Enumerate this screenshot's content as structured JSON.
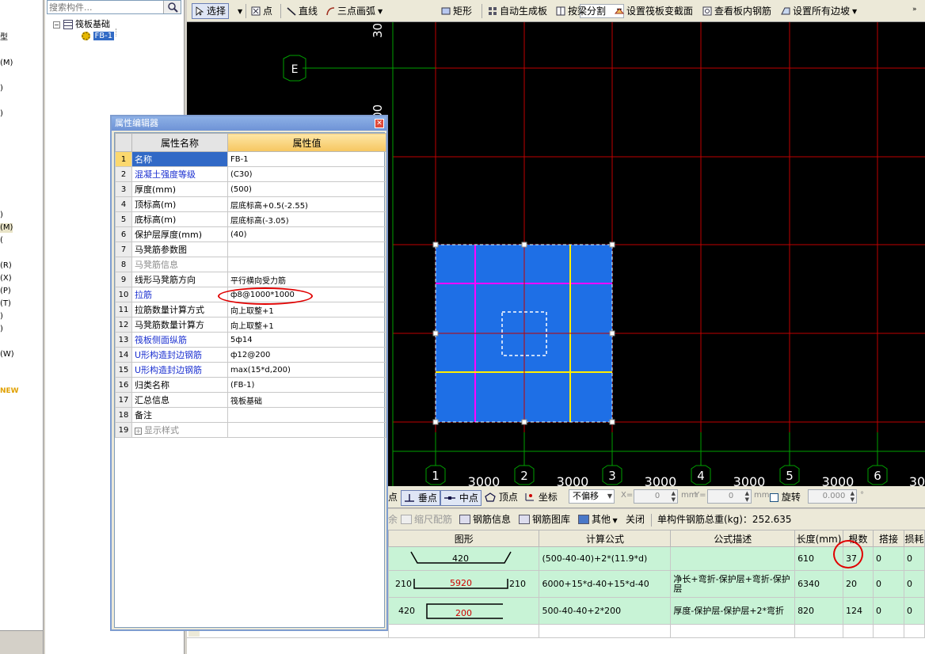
{
  "left_fragments": [
    "型",
    "(M)",
    ")",
    ")",
    ")",
    "(M)",
    "(",
    "(R)",
    "(X)",
    "(P)",
    "(T)",
    ")",
    ")",
    "(W)"
  ],
  "left_new_badge": "NEW",
  "search": {
    "placeholder": "搜索构件..."
  },
  "tree": {
    "root": {
      "label": "筏板基础",
      "toggle": "−"
    },
    "child": {
      "label": "FB-1"
    }
  },
  "toolbar": {
    "select": "选择",
    "point": "点",
    "line": "直线",
    "arc3": "三点画弧",
    "rect": "矩形",
    "autogen": "自动生成板",
    "split_by_beam": "按梁分割",
    "set_slab_section": "设置筏板变截面",
    "view_slab_rebar": "查看板内钢筋",
    "set_all_edges": "设置所有边坡"
  },
  "canvas": {
    "axis_labels_bottom": [
      "1",
      "2",
      "3",
      "4",
      "5",
      "6"
    ],
    "axis_label_left": "E",
    "dimension_labels": [
      "3000",
      "3000",
      "3000",
      "3000",
      "3000",
      "30"
    ],
    "dimension_vertical": [
      "30",
      "3000"
    ],
    "colors": {
      "background": "#000000",
      "grid_red": "#c00000",
      "grid_green": "#00b000",
      "slab_fill": "#1e6fe6",
      "rebar_magenta": "#ff00ff",
      "rebar_yellow": "#ffee00"
    }
  },
  "prop_editor": {
    "title": "属性编辑器",
    "col_name": "属性名称",
    "col_value": "属性值",
    "rows": [
      {
        "num": "1",
        "name": "名称",
        "value": "FB-1"
      },
      {
        "num": "2",
        "name": "混凝土强度等级",
        "value": "(C30)"
      },
      {
        "num": "3",
        "name": "厚度(mm)",
        "value": "(500)"
      },
      {
        "num": "4",
        "name": "顶标高(m)",
        "value": "层底标高+0.5(-2.55)"
      },
      {
        "num": "5",
        "name": "底标高(m)",
        "value": "层底标高(-3.05)"
      },
      {
        "num": "6",
        "name": "保护层厚度(mm)",
        "value": "(40)"
      },
      {
        "num": "7",
        "name": "马凳筋参数图",
        "value": ""
      },
      {
        "num": "8",
        "name": "马凳筋信息",
        "value": ""
      },
      {
        "num": "9",
        "name": "线形马凳筋方向",
        "value": "平行横向受力筋"
      },
      {
        "num": "10",
        "name": "拉筋",
        "value": "ф8@1000*1000"
      },
      {
        "num": "11",
        "name": "拉筋数量计算方式",
        "value": "向上取整+1"
      },
      {
        "num": "12",
        "name": "马凳筋数量计算方",
        "value": "向上取整+1"
      },
      {
        "num": "13",
        "name": "筏板侧面纵筋",
        "value": "5ф14"
      },
      {
        "num": "14",
        "name": "U形构造封边钢筋",
        "value": "ф12@200"
      },
      {
        "num": "15",
        "name": "U形构造封边钢筋",
        "value": "max(15*d,200)"
      },
      {
        "num": "16",
        "name": "归类名称",
        "value": "(FB-1)"
      },
      {
        "num": "17",
        "name": "汇总信息",
        "value": "筏板基础"
      },
      {
        "num": "18",
        "name": "备注",
        "value": ""
      },
      {
        "num": "19",
        "name": "显示样式",
        "value": "",
        "expander": "+"
      }
    ]
  },
  "snap_bar": {
    "point_fragment": "点",
    "perp": "垂点",
    "mid": "中点",
    "vertex": "顶点",
    "coord": "坐标",
    "offset_select": "不偏移",
    "x_label": "X=",
    "x_value": "0",
    "y_label": "Y=",
    "y_value": "0",
    "unit_mm": "mm",
    "rotate": "旋转",
    "rotate_value": "0.000",
    "degree": "°"
  },
  "rebar_bar": {
    "fragment": "余",
    "scale_config": "缩尺配筋",
    "rebar_info": "钢筋信息",
    "rebar_library": "钢筋图库",
    "other": "其他",
    "close": "关闭",
    "total_weight_label": "单构件钢筋总重(kg)：252.635"
  },
  "rebar_table": {
    "headers": [
      "图形",
      "计算公式",
      "公式描述",
      "长度(mm)",
      "根数",
      "搭接",
      "损耗"
    ],
    "rows": [
      {
        "shape_mid": "420",
        "formula": "(500-40-40)+2*(11.9*d)",
        "desc": "",
        "length": "610",
        "count": "37",
        "lap": "0",
        "loss": "0"
      },
      {
        "shape_left": "210",
        "shape_mid": "5920",
        "shape_right": "210",
        "formula": "6000+15*d-40+15*d-40",
        "desc": "净长+弯折-保护层+弯折-保护层",
        "length": "6340",
        "count": "20",
        "lap": "0",
        "loss": "0"
      },
      {
        "shape_left": "420",
        "shape_mid": "200",
        "formula": "500-40-40+2*200",
        "desc": "厚度-保护层-保护层+2*弯折",
        "length": "820",
        "count": "124",
        "lap": "0",
        "loss": "0"
      }
    ]
  }
}
